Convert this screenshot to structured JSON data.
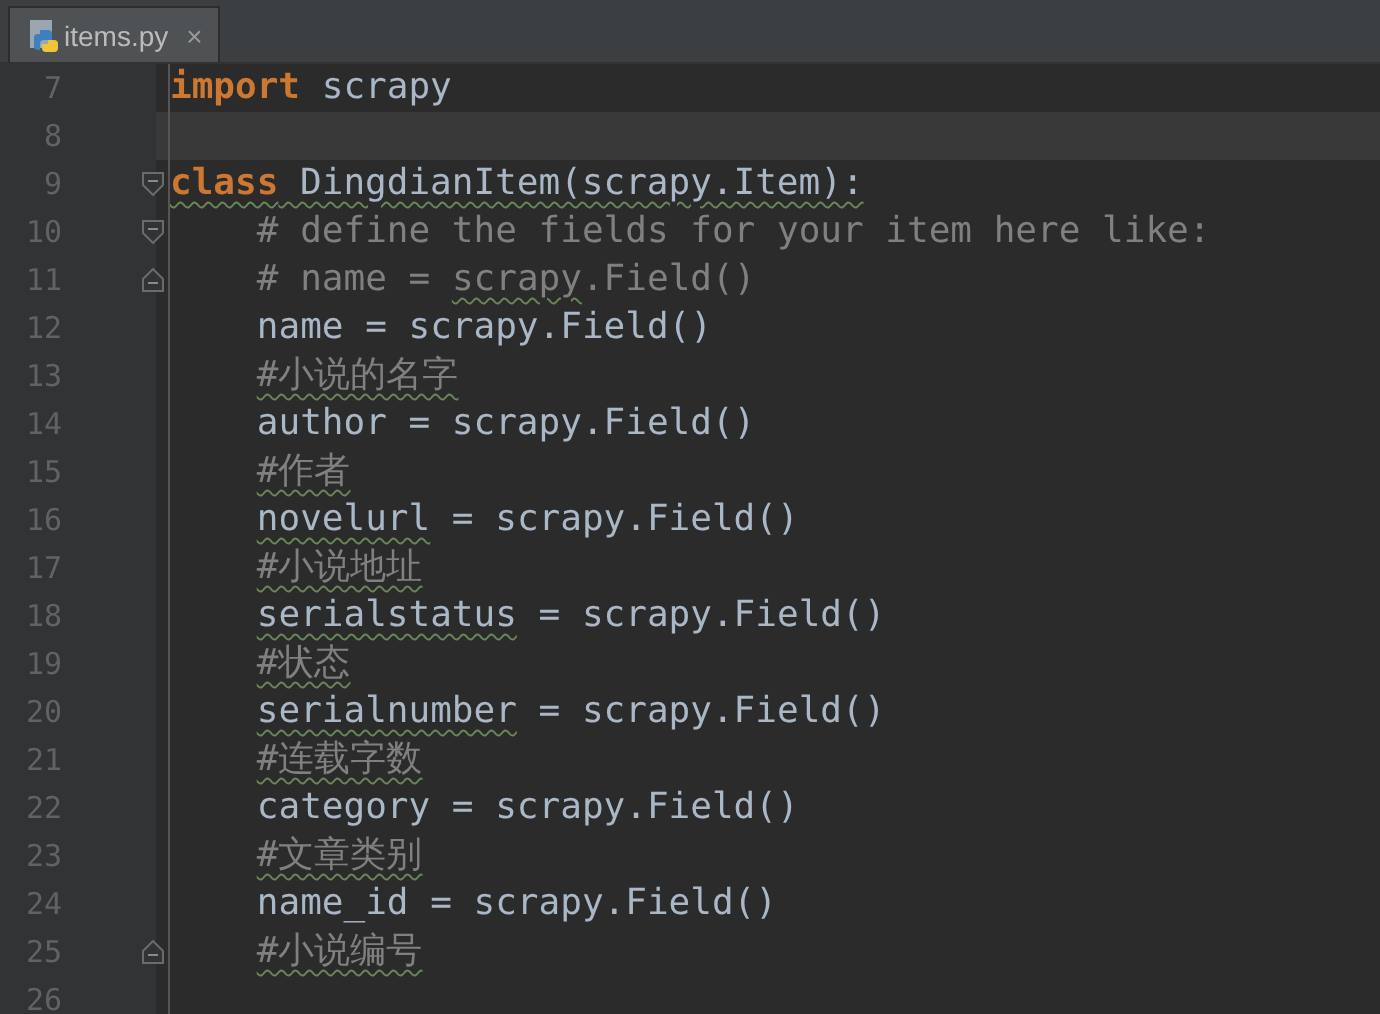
{
  "tabs": [
    {
      "label": "items.py",
      "close": "×",
      "selected": true
    }
  ],
  "lines": [
    {
      "number": "7",
      "current": false,
      "indent": false,
      "fold_start": false,
      "fold_end": false,
      "tokens": [
        {
          "text": "import",
          "kind": "keyword",
          "squiggle": false
        },
        {
          "text": " scrapy",
          "kind": "plain",
          "squiggle": false
        }
      ]
    },
    {
      "number": "8",
      "current": true,
      "fold_start": false,
      "fold_end": false
    },
    {
      "number": "9",
      "current": false,
      "indent": false,
      "fold_start": true,
      "fold_end": false,
      "tokens": [
        {
          "text": "class",
          "kind": "keyword",
          "squiggle": true
        },
        {
          "text": " DingdianItem(scrapy.Item):",
          "kind": "plain",
          "squiggle": true
        }
      ]
    },
    {
      "number": "10",
      "current": false,
      "indent": true,
      "fold_start": true,
      "fold_end": false,
      "tokens": [
        {
          "text": "# define the fields for your item here like:",
          "kind": "comment",
          "squiggle": false
        }
      ]
    },
    {
      "number": "11",
      "current": false,
      "indent": true,
      "fold_start": false,
      "fold_end": true,
      "tokens": [
        {
          "text": "# name = ",
          "kind": "comment",
          "squiggle": false
        },
        {
          "text": "scrapy",
          "kind": "comment",
          "squiggle": true
        },
        {
          "text": ".Field()",
          "kind": "comment",
          "squiggle": false
        }
      ]
    },
    {
      "number": "12",
      "current": false,
      "indent": true,
      "fold_start": false,
      "fold_end": false,
      "tokens": [
        {
          "text": "name = scrapy.Field()",
          "kind": "plain",
          "squiggle": false
        }
      ]
    },
    {
      "number": "13",
      "current": false,
      "indent": true,
      "fold_start": false,
      "fold_end": false,
      "tokens": [
        {
          "text": "#小说的名字",
          "kind": "comment",
          "squiggle": true
        }
      ]
    },
    {
      "number": "14",
      "current": false,
      "indent": true,
      "fold_start": false,
      "fold_end": false,
      "tokens": [
        {
          "text": "author = scrapy.Field()",
          "kind": "plain",
          "squiggle": false
        }
      ]
    },
    {
      "number": "15",
      "current": false,
      "indent": true,
      "fold_start": false,
      "fold_end": false,
      "tokens": [
        {
          "text": "#作者",
          "kind": "comment",
          "squiggle": true
        }
      ]
    },
    {
      "number": "16",
      "current": false,
      "indent": true,
      "fold_start": false,
      "fold_end": false,
      "tokens": [
        {
          "text": "novelurl",
          "kind": "plain",
          "squiggle": true
        },
        {
          "text": " = scrapy.Field()",
          "kind": "plain",
          "squiggle": false
        }
      ]
    },
    {
      "number": "17",
      "current": false,
      "indent": true,
      "fold_start": false,
      "fold_end": false,
      "tokens": [
        {
          "text": "#小说地址",
          "kind": "comment",
          "squiggle": true
        }
      ]
    },
    {
      "number": "18",
      "current": false,
      "indent": true,
      "fold_start": false,
      "fold_end": false,
      "tokens": [
        {
          "text": "serialstatus",
          "kind": "plain",
          "squiggle": true
        },
        {
          "text": " = scrapy.Field()",
          "kind": "plain",
          "squiggle": false
        }
      ]
    },
    {
      "number": "19",
      "current": false,
      "indent": true,
      "fold_start": false,
      "fold_end": false,
      "tokens": [
        {
          "text": "#状态",
          "kind": "comment",
          "squiggle": true
        }
      ]
    },
    {
      "number": "20",
      "current": false,
      "indent": true,
      "fold_start": false,
      "fold_end": false,
      "tokens": [
        {
          "text": "serialnumber",
          "kind": "plain",
          "squiggle": true
        },
        {
          "text": " = scrapy.Field()",
          "kind": "plain",
          "squiggle": false
        }
      ]
    },
    {
      "number": "21",
      "current": false,
      "indent": true,
      "fold_start": false,
      "fold_end": false,
      "tokens": [
        {
          "text": "#连载字数",
          "kind": "comment",
          "squiggle": true
        }
      ]
    },
    {
      "number": "22",
      "current": false,
      "indent": true,
      "fold_start": false,
      "fold_end": false,
      "tokens": [
        {
          "text": "category = scrapy.Field()",
          "kind": "plain",
          "squiggle": false
        }
      ]
    },
    {
      "number": "23",
      "current": false,
      "indent": true,
      "fold_start": false,
      "fold_end": false,
      "tokens": [
        {
          "text": "#文章类别",
          "kind": "comment",
          "squiggle": true
        }
      ]
    },
    {
      "number": "24",
      "current": false,
      "indent": true,
      "fold_start": false,
      "fold_end": false,
      "tokens": [
        {
          "text": "name_id = scrapy.Field()",
          "kind": "plain",
          "squiggle": false
        }
      ]
    },
    {
      "number": "25",
      "current": false,
      "indent": true,
      "fold_start": false,
      "fold_end": true,
      "tokens": [
        {
          "text": "#小说编号",
          "kind": "comment",
          "squiggle": true
        }
      ]
    },
    {
      "number": "26",
      "current": false,
      "fold_start": false,
      "fold_end": false
    }
  ]
}
